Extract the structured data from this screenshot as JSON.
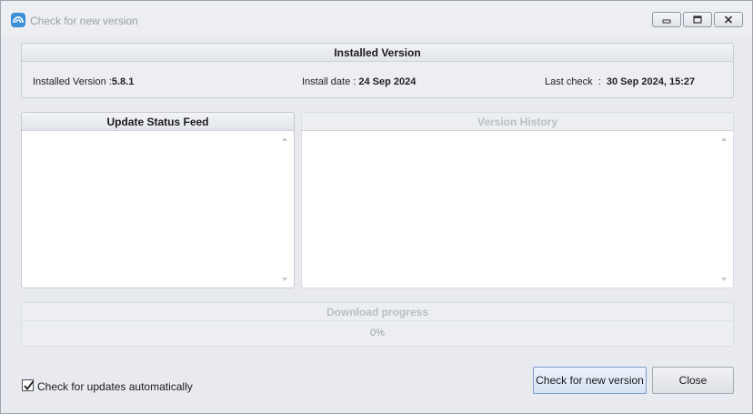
{
  "window": {
    "title": "Check for new version",
    "icon": "app-cloud-icon",
    "controls": [
      "minimize-icon",
      "restore-icon",
      "close-icon"
    ]
  },
  "installed": {
    "header": "Installed Version",
    "version_label": "Installed Version :",
    "version_value": "5.8.1",
    "date_label": "Install date : ",
    "date_value": "24 Sep 2024",
    "check_label": "Last check  :  ",
    "check_value": "30 Sep 2024, 15:27"
  },
  "feeds": {
    "status_header": "Update Status Feed",
    "history_header": "Version History"
  },
  "progress": {
    "header": "Download progress",
    "value_text": "0%",
    "value": 0
  },
  "footer": {
    "auto_check_label": "Check for updates automatically",
    "auto_check_checked": true,
    "check_button": "Check for new version",
    "close_button": "Close"
  },
  "colors": {
    "accent": "#3a8fd6",
    "window_bg": "#e8eaef",
    "disabled_text": "#b9bdc4"
  }
}
